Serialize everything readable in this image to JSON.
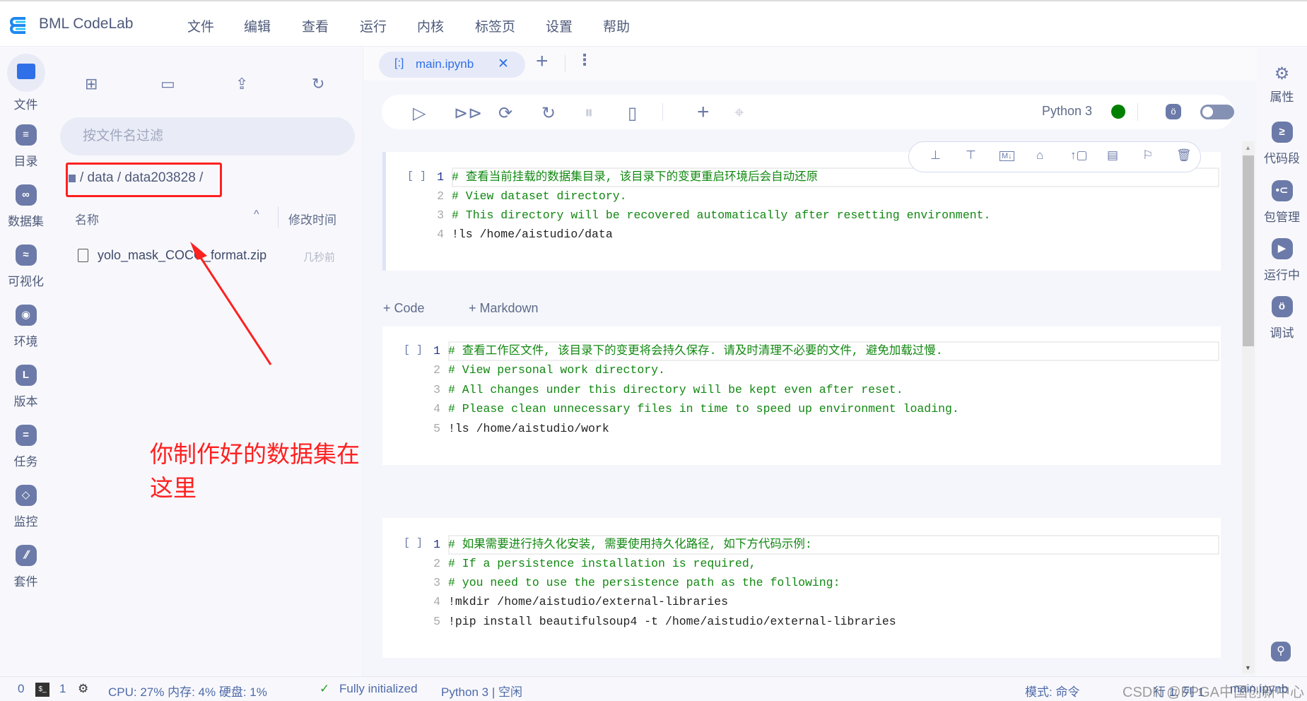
{
  "app": {
    "title": "BML CodeLab"
  },
  "menu": [
    "文件",
    "编辑",
    "查看",
    "运行",
    "内核",
    "标签页",
    "设置",
    "帮助"
  ],
  "left_rail": [
    {
      "label": "文件",
      "icon": "folder-icon"
    },
    {
      "label": "目录",
      "icon": "toc-icon"
    },
    {
      "label": "数据集",
      "icon": "dataset-icon"
    },
    {
      "label": "可视化",
      "icon": "chart-icon"
    },
    {
      "label": "环境",
      "icon": "environment-icon"
    },
    {
      "label": "版本",
      "icon": "version-icon"
    },
    {
      "label": "任务",
      "icon": "task-icon"
    },
    {
      "label": "监控",
      "icon": "monitor-icon"
    },
    {
      "label": "套件",
      "icon": "suite-icon"
    }
  ],
  "file_panel": {
    "filter_placeholder": "按文件名过滤",
    "breadcrumb": "/ data / data203828 /",
    "col_name": "名称",
    "col_modified": "修改时间",
    "files": [
      {
        "name": "yolo_mask_COCO_format.zip",
        "modified": "几秒前"
      }
    ]
  },
  "annotation": {
    "text": "你制作好的数据集在这里",
    "color": "#ff2a2a"
  },
  "tabs": [
    {
      "label": "main.ipynb",
      "active": true
    }
  ],
  "toolbar": {
    "kernel": "Python 3",
    "kernel_status_color": "#008000"
  },
  "add_cell": {
    "code": "+ Code",
    "markdown": "+ Markdown"
  },
  "cells": [
    {
      "prompt": "[ ]",
      "lines": [
        {
          "t": "# 查看当前挂载的数据集目录, 该目录下的变更重启环境后会自动还原",
          "c": true
        },
        {
          "t": "# View dataset directory.",
          "c": true
        },
        {
          "t": "# This directory will be recovered automatically after resetting environment.",
          "c": true
        },
        {
          "t": "!ls /home/aistudio/data",
          "c": false
        }
      ]
    },
    {
      "prompt": "[ ]",
      "lines": [
        {
          "t": "# 查看工作区文件, 该目录下的变更将会持久保存. 请及时清理不必要的文件, 避免加载过慢.",
          "c": true
        },
        {
          "t": "# View personal work directory.",
          "c": true
        },
        {
          "t": "# All changes under this directory will be kept even after reset.",
          "c": true
        },
        {
          "t": "# Please clean unnecessary files in time to speed up environment loading.",
          "c": true
        },
        {
          "t": "!ls /home/aistudio/work",
          "c": false
        }
      ]
    },
    {
      "prompt": "[ ]",
      "lines": [
        {
          "t": "# 如果需要进行持久化安装, 需要使用持久化路径, 如下方代码示例:",
          "c": true
        },
        {
          "t": "# If a persistence installation is required,",
          "c": true
        },
        {
          "t": "# you need to use the persistence path as the following:",
          "c": true
        },
        {
          "t": "!mkdir /home/aistudio/external-libraries",
          "c": false
        },
        {
          "t": "!pip install beautifulsoup4 -t /home/aistudio/external-libraries",
          "c": false
        }
      ]
    }
  ],
  "right_rail": [
    {
      "label": "属性",
      "icon": "gears-icon"
    },
    {
      "label": "代码段",
      "icon": "snippet-icon"
    },
    {
      "label": "包管理",
      "icon": "package-icon"
    },
    {
      "label": "运行中",
      "icon": "running-icon"
    },
    {
      "label": "调试",
      "icon": "debug-icon"
    }
  ],
  "status": {
    "terminals": "0",
    "kernels": "1",
    "resources": "CPU:  27% 内存:  4% 硬盘:  1%",
    "init": "Fully initialized",
    "kernel": "Python 3 | 空闲",
    "mode": "模式:  命令",
    "cursor": "行 1, 列 1",
    "file": "main.ipynb",
    "watermark": "CSDN @FPGA中国创新中心"
  }
}
